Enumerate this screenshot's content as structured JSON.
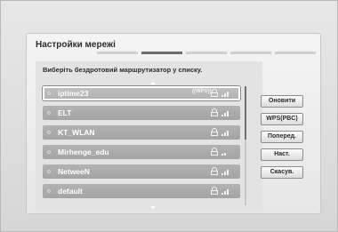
{
  "dialog": {
    "title": "Настройки мережі",
    "instruction": "Виберіть бездротовий маршрутизатор у списку.",
    "progress_steps": 5,
    "progress_active_step": 2
  },
  "networks": [
    {
      "name": "iptime23",
      "wps": "((WPS))",
      "selected": true
    },
    {
      "name": "ELT",
      "wps": "",
      "selected": false
    },
    {
      "name": "KT_WLAN",
      "wps": "",
      "selected": false
    },
    {
      "name": "Mirhenge_edu",
      "wps": "",
      "selected": false
    },
    {
      "name": "NetweeN",
      "wps": "",
      "selected": false
    },
    {
      "name": "default",
      "wps": "",
      "selected": false
    }
  ],
  "buttons": {
    "refresh": "Оновити",
    "wps_pbc": "WPS(PBC)",
    "previous": "Поперед.",
    "next": "Наст.",
    "cancel": "Скасув."
  },
  "icons": {
    "lock": "lock-icon",
    "signal": "signal-strength-icon",
    "scroll_up": "arrow-up-icon",
    "scroll_down": "arrow-down-icon"
  },
  "colors": {
    "row_bg": "#a9a9a9",
    "selected_border": "#ffffff",
    "progress_active": "#6d6d6d"
  }
}
